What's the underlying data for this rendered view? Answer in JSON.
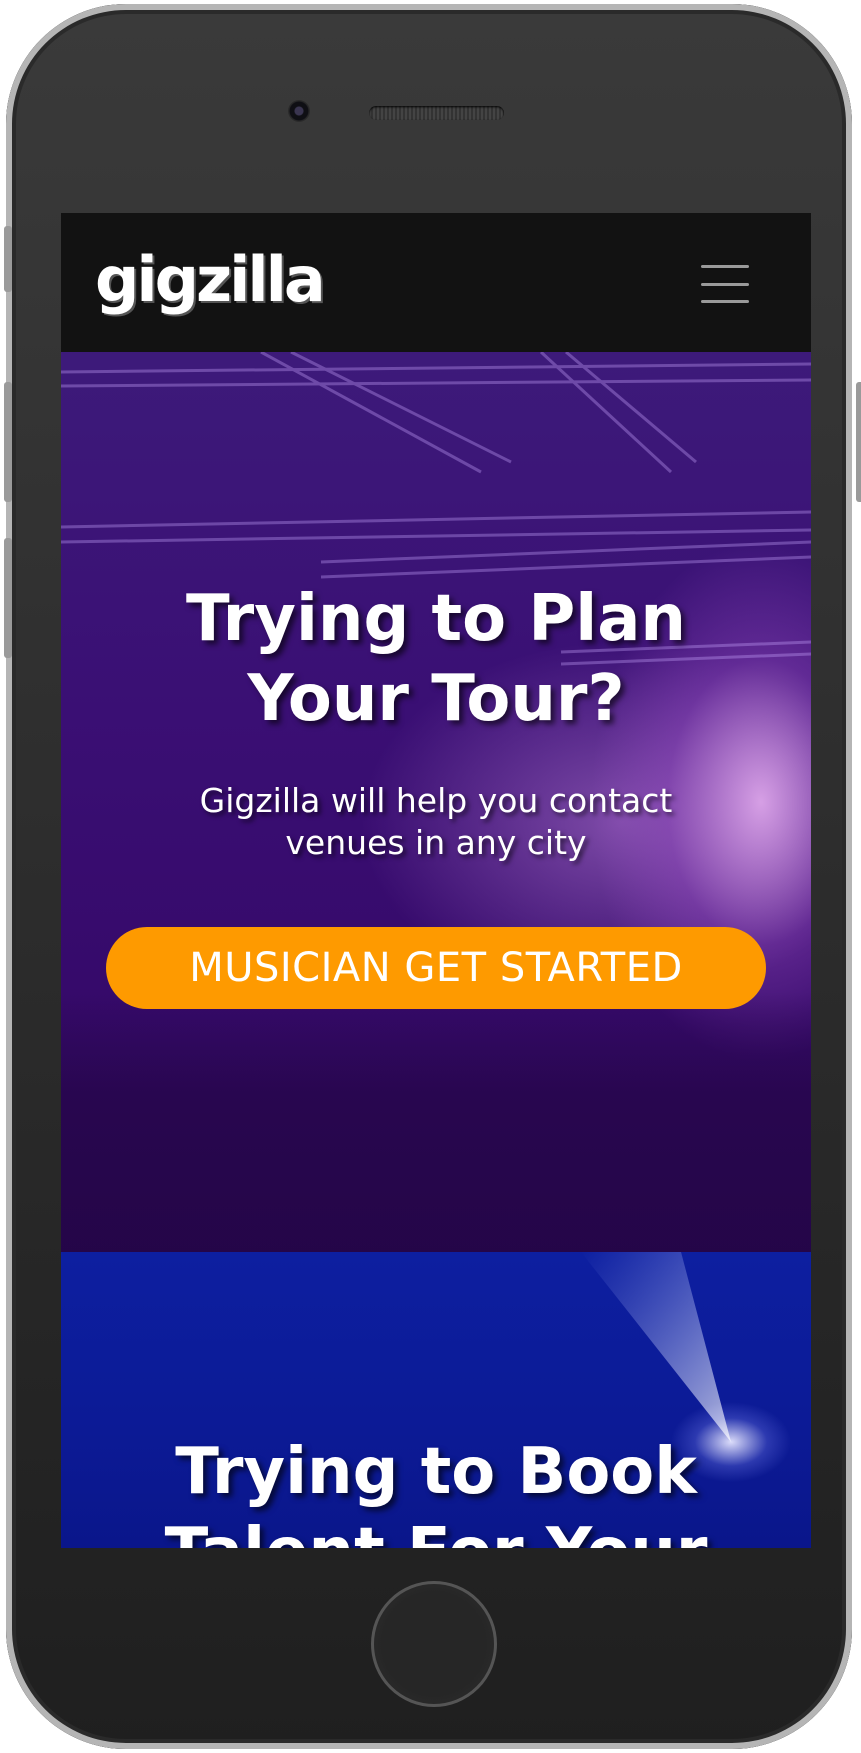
{
  "brand": {
    "logo_text": "gigzilla"
  },
  "hero": {
    "title": "Trying to Plan Your Tour?",
    "subtitle": "Gigzilla will help you contact venues in any city",
    "cta_label": "MUSICIAN GET STARTED"
  },
  "section2": {
    "title": "Trying to Book Talent For Your"
  },
  "colors": {
    "navbar": "#121212",
    "hero_tint": "#3a0f74",
    "cta": "#fe9a00",
    "section2_tint": "#0d1fa0"
  },
  "icons": {
    "menu": "hamburger-menu-icon"
  }
}
